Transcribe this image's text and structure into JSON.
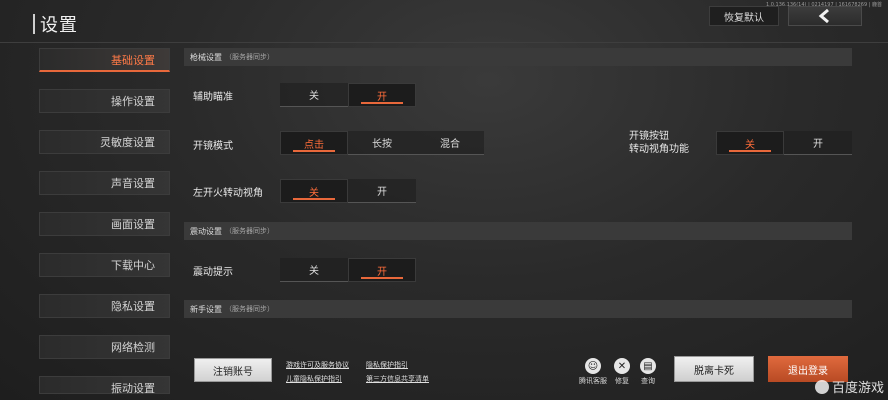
{
  "header": {
    "title": "设置",
    "version": "1.0.136.136(14) | 0214197 | 161678269 | 鹿首",
    "restore_label": "恢复默认",
    "back_icon": "chevron-left-icon"
  },
  "sidebar": {
    "items": [
      {
        "label": "基础设置",
        "active": true
      },
      {
        "label": "操作设置",
        "active": false
      },
      {
        "label": "灵敏度设置",
        "active": false
      },
      {
        "label": "声音设置",
        "active": false
      },
      {
        "label": "画面设置",
        "active": false
      },
      {
        "label": "下载中心",
        "active": false
      },
      {
        "label": "隐私设置",
        "active": false
      },
      {
        "label": "网络检测",
        "active": false
      },
      {
        "label": "振动设置",
        "active": false
      }
    ]
  },
  "sections": {
    "gun": {
      "title": "枪械设置",
      "sub": "（服务器同步）"
    },
    "vibration": {
      "title": "震动设置",
      "sub": "（服务器同步）"
    },
    "novice": {
      "title": "新手设置",
      "sub": "（服务器同步）"
    }
  },
  "rows": {
    "aim_assist": {
      "label": "辅助瞄准",
      "options": [
        "关",
        "开"
      ],
      "selected": 1
    },
    "scope_mode": {
      "label": "开镜模式",
      "options": [
        "点击",
        "长按",
        "混合"
      ],
      "selected": 0
    },
    "scope_button": {
      "label_line1": "开镜按钮",
      "label_line2": "转动视角功能",
      "options": [
        "关",
        "开"
      ],
      "selected": 0
    },
    "left_fire": {
      "label": "左开火转动视角",
      "options": [
        "关",
        "开"
      ],
      "selected": 0
    },
    "vibration_hint": {
      "label": "震动提示",
      "options": [
        "关",
        "开"
      ],
      "selected": 1
    }
  },
  "footer": {
    "cancel_account": "注销账号",
    "links": {
      "license": "游戏许可及服务协议",
      "privacy": "隐私保护指引",
      "child_privacy": "儿童隐私保护指引",
      "third_party": "第三方信息共享清单"
    },
    "tools": [
      {
        "icon": "tencent-support-icon",
        "label": "腾讯客服",
        "glyph": "☺"
      },
      {
        "icon": "wrench-repair-icon",
        "label": "修复",
        "glyph": "✕"
      },
      {
        "icon": "query-search-icon",
        "label": "查询",
        "glyph": "▤"
      }
    ],
    "stuck_label": "脱离卡死",
    "logout_label": "退出登录"
  },
  "watermark": "百度游戏",
  "colors": {
    "accent": "#e8683b",
    "panel": "#3a3a3a"
  }
}
